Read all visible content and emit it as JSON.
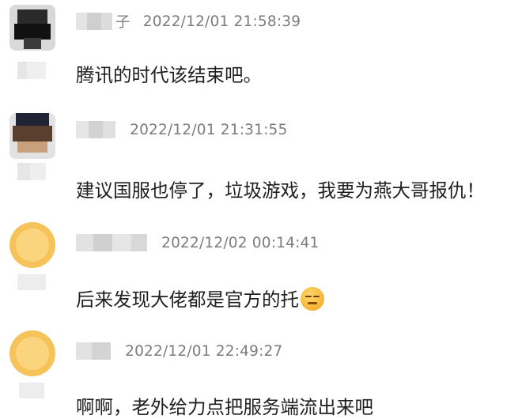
{
  "comments": [
    {
      "username_visible": "子",
      "timestamp": "2022/12/01 21:58:39",
      "text": "腾讯的时代该结束吧。"
    },
    {
      "username_visible": "",
      "timestamp": "2022/12/01 21:31:55",
      "text": "建议国服也停了，垃圾游戏，我要为燕大哥报仇！"
    },
    {
      "username_visible": "",
      "timestamp": "2022/12/02 00:14:41",
      "text": "后来发现大佬都是官方的托"
    },
    {
      "username_visible": "",
      "timestamp": "2022/12/01 22:49:27",
      "text": "啊啊，老外给力点把服务端流出来吧"
    }
  ],
  "icons": {
    "emoji": "smirk-emoji-icon"
  },
  "colors": {
    "timestamp": "#7c7c7c",
    "text": "#1f1f1f",
    "avatar_yellow": "#f6c35a"
  }
}
